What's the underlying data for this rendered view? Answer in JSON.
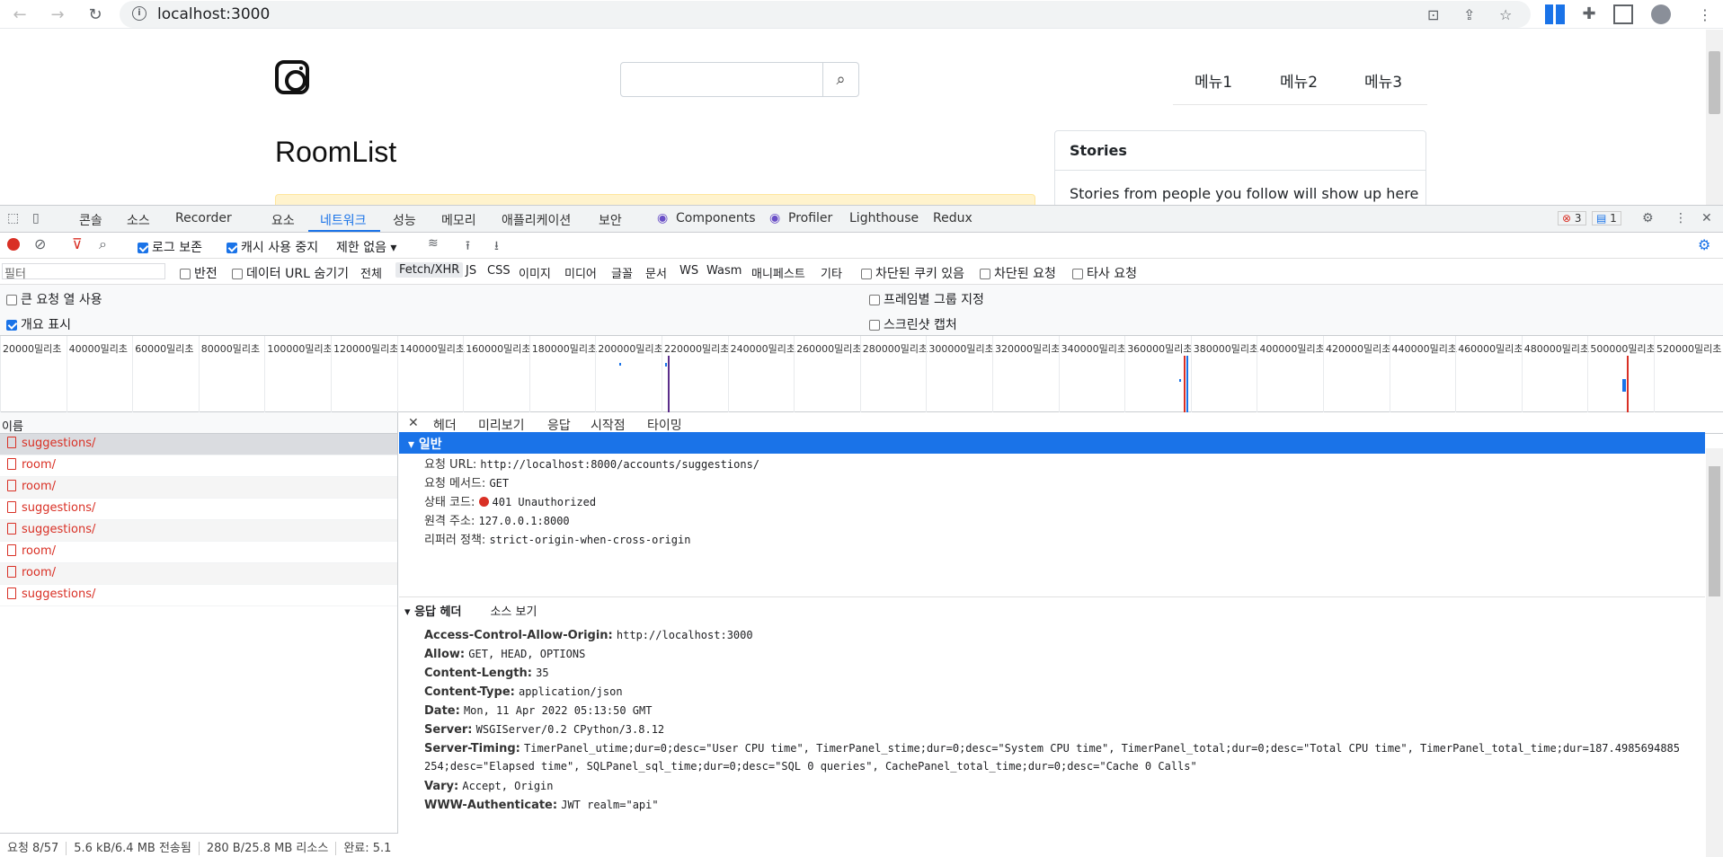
{
  "browser": {
    "url": "localhost:3000"
  },
  "page": {
    "menus": [
      "메뉴1",
      "메뉴2",
      "메뉴3"
    ],
    "title": "RoomList",
    "stories_title": "Stories",
    "stories_text": "Stories from people you follow will show up here"
  },
  "devtools": {
    "tabs": [
      "콘솔",
      "소스",
      "Recorder",
      "요소",
      "네트워크",
      "성능",
      "메모리",
      "애플리케이션",
      "보안",
      "Components",
      "Profiler",
      "Lighthouse",
      "Redux"
    ],
    "error_count": "3",
    "message_count": "1",
    "toolbar": {
      "preserve_log": "로그 보존",
      "disable_cache": "캐시 사용 중지",
      "throttle": "제한 없음"
    },
    "filter": {
      "placeholder": "필터",
      "invert": "반전",
      "hide_data_urls": "데이터 URL 숨기기",
      "types": [
        "전체",
        "Fetch/XHR",
        "JS",
        "CSS",
        "이미지",
        "미디어",
        "글꼴",
        "문서",
        "WS",
        "Wasm",
        "매니페스트",
        "기타"
      ],
      "blocked_cookies": "차단된 쿠키 있음",
      "blocked_requests": "차단된 요청",
      "third_party": "타사 요청"
    },
    "options": {
      "large_rows": "큰 요청 열 사용",
      "group_by_frame": "프레임별 그룹 지정",
      "show_overview": "개요 표시",
      "capture_screenshots": "스크린샷 캡처"
    },
    "timeline_ticks": [
      "20000밀리초",
      "40000밀리초",
      "60000밀리초",
      "80000밀리초",
      "100000밀리초",
      "120000밀리초",
      "140000밀리초",
      "160000밀리초",
      "180000밀리초",
      "200000밀리초",
      "220000밀리초",
      "240000밀리초",
      "260000밀리초",
      "280000밀리초",
      "300000밀리초",
      "320000밀리초",
      "340000밀리초",
      "360000밀리초",
      "380000밀리초",
      "400000밀리초",
      "420000밀리초",
      "440000밀리초",
      "460000밀리초",
      "480000밀리초",
      "500000밀리초",
      "520000밀리초"
    ],
    "name_header": "이름",
    "requests": [
      "suggestions/",
      "room/",
      "room/",
      "suggestions/",
      "suggestions/",
      "room/",
      "room/",
      "suggestions/"
    ],
    "status_bar": [
      "요청 8/57",
      "5.6 kB/6.4 MB 전송됨",
      "280 B/25.8 MB 리소스",
      "완료: 5.1"
    ],
    "detail_tabs": [
      "헤더",
      "미리보기",
      "응답",
      "시작점",
      "타이밍"
    ],
    "general": {
      "section": "일반",
      "rows": [
        {
          "k": "요청 URL:",
          "v": "http://localhost:8000/accounts/suggestions/"
        },
        {
          "k": "요청 메서드:",
          "v": "GET"
        },
        {
          "k": "상태 코드:",
          "v": "401 Unauthorized"
        },
        {
          "k": "원격 주소:",
          "v": "127.0.0.1:8000"
        },
        {
          "k": "리퍼러 정책:",
          "v": "strict-origin-when-cross-origin"
        }
      ]
    },
    "response_headers": {
      "section": "응답 헤더",
      "view_source": "소스 보기",
      "rows": [
        {
          "k": "Access-Control-Allow-Origin:",
          "v": "http://localhost:3000"
        },
        {
          "k": "Allow:",
          "v": "GET, HEAD, OPTIONS"
        },
        {
          "k": "Content-Length:",
          "v": "35"
        },
        {
          "k": "Content-Type:",
          "v": "application/json"
        },
        {
          "k": "Date:",
          "v": "Mon, 11 Apr 2022 05:13:50 GMT"
        },
        {
          "k": "Server:",
          "v": "WSGIServer/0.2 CPython/3.8.12"
        },
        {
          "k": "Server-Timing:",
          "v": "TimerPanel_utime;dur=0;desc=\"User CPU time\", TimerPanel_stime;dur=0;desc=\"System CPU time\", TimerPanel_total;dur=0;desc=\"Total CPU time\", TimerPanel_total_time;dur=187.4985694885",
          "v2": "254;desc=\"Elapsed time\", SQLPanel_sql_time;dur=0;desc=\"SQL 0 queries\", CachePanel_total_time;dur=0;desc=\"Cache 0 Calls\""
        },
        {
          "k": "Vary:",
          "v": "Accept, Origin"
        },
        {
          "k": "WWW-Authenticate:",
          "v": "JWT realm=\"api\""
        }
      ]
    }
  }
}
